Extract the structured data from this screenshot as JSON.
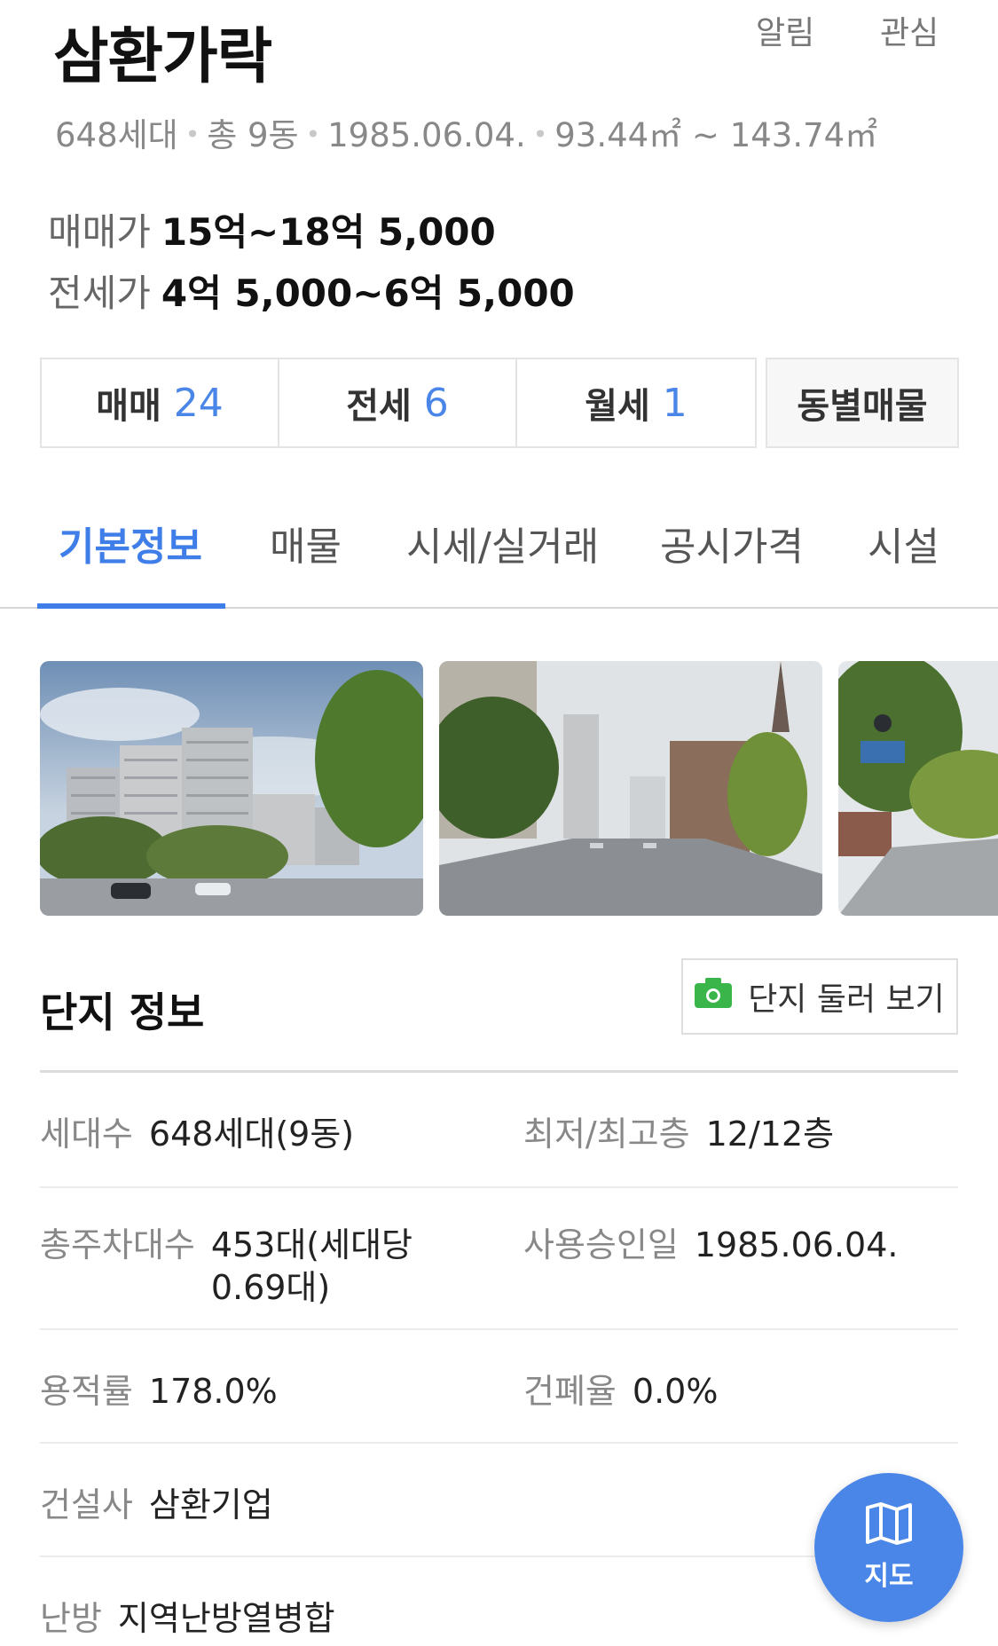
{
  "header": {
    "title": "삼환가락",
    "alarm_label": "알림",
    "favorite_label": "관심"
  },
  "summary": {
    "households": "648세대",
    "buildings": "총 9동",
    "approval_date": "1985.06.04.",
    "area_range": "93.44㎡ ~ 143.74㎡"
  },
  "prices": {
    "sale_label": "매매가",
    "sale_value": "15억~18억 5,000",
    "jeonse_label": "전세가",
    "jeonse_value": "4억 5,000~6억 5,000"
  },
  "deals": [
    {
      "label": "매매",
      "count": "24"
    },
    {
      "label": "전세",
      "count": "6"
    },
    {
      "label": "월세",
      "count": "1"
    }
  ],
  "by_dong_label": "동별매물",
  "tabs": [
    {
      "label": "기본정보",
      "active": true
    },
    {
      "label": "매물",
      "active": false
    },
    {
      "label": "시세/실거래",
      "active": false
    },
    {
      "label": "공시가격",
      "active": false
    },
    {
      "label": "시설",
      "active": false
    }
  ],
  "complex": {
    "title": "단지 정보",
    "tour_label": "단지 둘러 보기",
    "rows": [
      {
        "k1": "세대수",
        "v1": "648세대(9동)",
        "k2": "최저/최고층",
        "v2": "12/12층"
      },
      {
        "k1": "총주차대수",
        "v1": "453대(세대당 0.69대)",
        "k2": "사용승인일",
        "v2": "1985.06.04."
      },
      {
        "k1": "용적률",
        "v1": "178.0%",
        "k2": "건폐율",
        "v2": "0.0%"
      },
      {
        "k1": "건설사",
        "v1": "삼환기업",
        "k2": "",
        "v2": ""
      },
      {
        "k1": "난방",
        "v1": "지역난방열병합",
        "k2": "",
        "v2": ""
      }
    ]
  },
  "map_button_label": "지도",
  "colors": {
    "accent": "#4a86e8",
    "tab_active": "#3f7ee8",
    "camera_green": "#3ab54a"
  },
  "icons": [
    "camera-icon",
    "map-icon"
  ]
}
